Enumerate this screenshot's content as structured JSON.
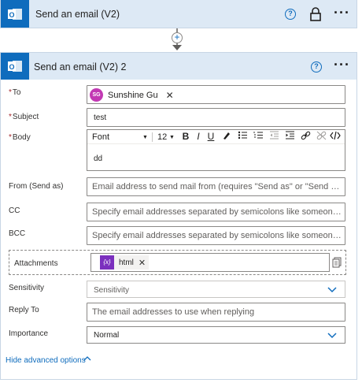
{
  "card1": {
    "title": "Send an email (V2)",
    "help_icon": "help-circle-icon",
    "lock_icon": "lock-icon",
    "more": "···"
  },
  "connector": {
    "plus": "+"
  },
  "card2": {
    "title": "Send an email (V2) 2",
    "help_icon": "help-circle-icon",
    "more": "···"
  },
  "fields": {
    "to": {
      "required_mark": "*",
      "label": "To",
      "token_initials": "SG",
      "token_name": "Sunshine Gu",
      "token_remove": "✕"
    },
    "subject": {
      "required_mark": "*",
      "label": "Subject",
      "value": "test"
    },
    "body": {
      "required_mark": "*",
      "label": "Body",
      "toolbar": {
        "font": "Font",
        "size": "12",
        "bold": "B",
        "italic": "I",
        "underline": "U"
      },
      "value": "dd"
    },
    "from": {
      "label": "From (Send as)",
      "placeholder": "Email address to send mail from (requires \"Send as\" or \"Send on b..."
    },
    "cc": {
      "label": "CC",
      "placeholder": "Specify email addresses separated by semicolons like someone@c..."
    },
    "bcc": {
      "label": "BCC",
      "placeholder": "Specify email addresses separated by semicolons like someone@c..."
    },
    "attachments": {
      "label": "Attachments",
      "token_icon": "{x}",
      "token_name": "html",
      "token_remove": "✕"
    },
    "sensitivity": {
      "label": "Sensitivity",
      "placeholder": "Sensitivity"
    },
    "reply_to": {
      "label": "Reply To",
      "placeholder": "The email addresses to use when replying"
    },
    "importance": {
      "label": "Importance",
      "value": "Normal"
    }
  },
  "footer": {
    "advanced_label": "Hide advanced options"
  },
  "colors": {
    "accent": "#0f6cbd",
    "header_bg": "#dde9f5",
    "avatar": "#c239b3",
    "expression": "#7b2fbe",
    "required": "#a4262c"
  }
}
